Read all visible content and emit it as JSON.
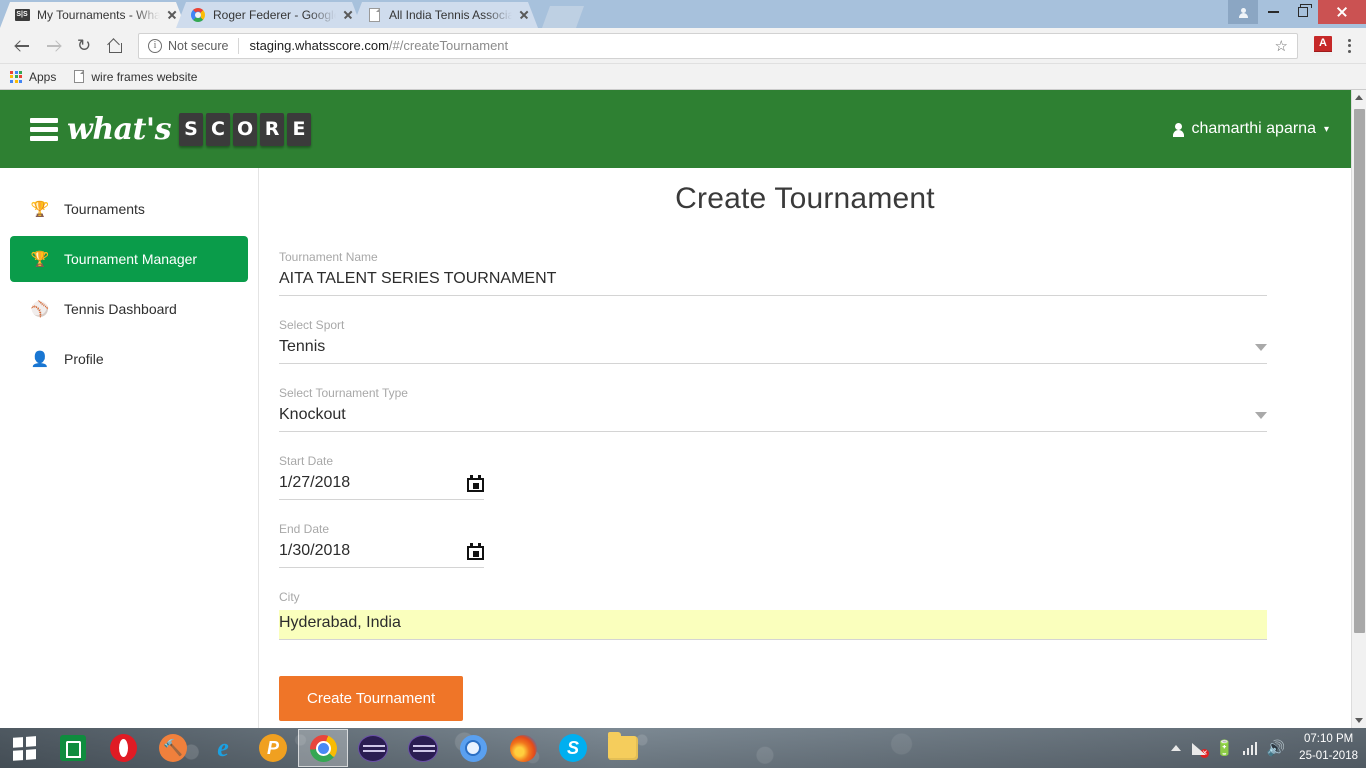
{
  "browser": {
    "tabs": [
      {
        "title": "My Tournaments - What'",
        "favicon": "score-favicon",
        "active": true
      },
      {
        "title": "Roger Federer - Google S",
        "favicon": "google-favicon",
        "active": false
      },
      {
        "title": "All India Tennis Associati",
        "favicon": "document-favicon",
        "active": false
      }
    ],
    "security_label": "Not secure",
    "url_host": "staging.whatsscore.com",
    "url_path": "/#/createTournament",
    "bookmarks": [
      {
        "label": "Apps",
        "icon": "apps-grid-icon"
      },
      {
        "label": "wire frames website",
        "icon": "document-icon"
      }
    ],
    "window_controls": {
      "profile": "profile-icon",
      "minimize": "minimize-icon",
      "maximize": "restore-icon",
      "close": "close-icon"
    }
  },
  "app": {
    "logo": {
      "word": "what's",
      "tiles": [
        "S",
        "C",
        "O",
        "R",
        "E"
      ]
    },
    "user": {
      "name": "chamarthi aparna",
      "caret": "▾"
    },
    "colors": {
      "header_green": "#2e8032",
      "active_green": "#0a9c4a",
      "button_orange": "#ef7528",
      "autofill_yellow": "#faffbd"
    }
  },
  "sidebar": {
    "items": [
      {
        "label": "Tournaments",
        "icon": "🏆",
        "icon_name": "trophy-icon",
        "active": false
      },
      {
        "label": "Tournament Manager",
        "icon": "🏆",
        "icon_name": "trophy-icon",
        "active": true
      },
      {
        "label": "Tennis Dashboard",
        "icon": "⚾",
        "icon_name": "dashboard-icon",
        "active": false
      },
      {
        "label": "Profile",
        "icon": "👤",
        "icon_name": "person-icon",
        "active": false
      }
    ]
  },
  "main": {
    "title": "Create Tournament",
    "fields": [
      {
        "label": "Tournament Name",
        "value": "AITA TALENT SERIES TOURNAMENT",
        "type": "text"
      },
      {
        "label": "Select Sport",
        "value": "Tennis",
        "type": "select"
      },
      {
        "label": "Select Tournament Type",
        "value": "Knockout",
        "type": "select"
      },
      {
        "label": "Start Date",
        "value": "1/27/2018",
        "type": "date"
      },
      {
        "label": "End Date",
        "value": "1/30/2018",
        "type": "date"
      },
      {
        "label": "City",
        "value": "Hyderabad, India",
        "type": "autofill"
      }
    ],
    "submit_label": "Create Tournament"
  },
  "taskbar": {
    "start": "windows-start-icon",
    "apps": [
      {
        "name": "store-icon",
        "active": false
      },
      {
        "name": "opera-icon",
        "active": false
      },
      {
        "name": "tool-icon",
        "active": false
      },
      {
        "name": "internet-explorer-icon",
        "active": false
      },
      {
        "name": "paint-icon",
        "active": false
      },
      {
        "name": "chrome-icon",
        "active": true
      },
      {
        "name": "app-oval-icon",
        "active": false
      },
      {
        "name": "app-oval-icon-2",
        "active": false
      },
      {
        "name": "chromium-icon",
        "active": false
      },
      {
        "name": "firefox-icon",
        "active": false
      },
      {
        "name": "skype-icon",
        "active": false
      },
      {
        "name": "file-explorer-icon",
        "active": false
      }
    ],
    "tray": [
      "show-hidden-icons",
      "network-error-icon",
      "battery-icon",
      "signal-icon",
      "volume-icon"
    ],
    "time": "07:10 PM",
    "date": "25-01-2018"
  }
}
